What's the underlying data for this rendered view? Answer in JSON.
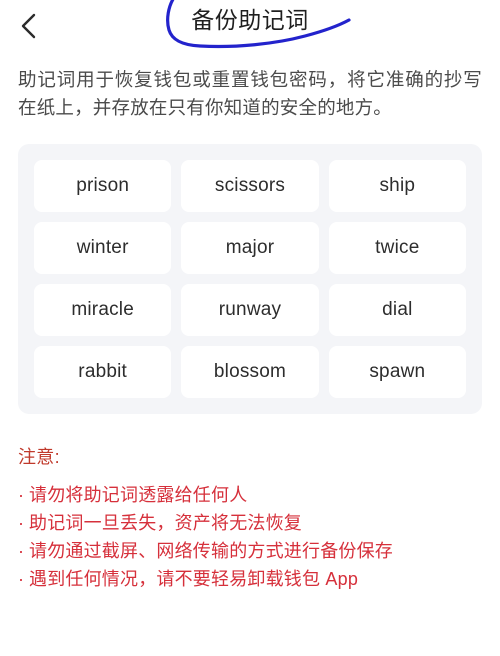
{
  "header": {
    "back_icon": "chevron-left-icon",
    "title": "备份助记词",
    "annotation_color": "#2323cc"
  },
  "description": "助记词用于恢复钱包或重置钱包密码，将它准确的抄写在纸上，并存放在只有你知道的安全的地方。",
  "mnemonic": {
    "words": [
      "prison",
      "scissors",
      "ship",
      "winter",
      "major",
      "twice",
      "miracle",
      "runway",
      "dial",
      "rabbit",
      "blossom",
      "spawn"
    ],
    "panel_background": "#f4f5f8",
    "card_background": "#ffffff"
  },
  "warning": {
    "title": "注意:",
    "bullet": "·",
    "color": "#d6303b",
    "items": [
      "请勿将助记词透露给任何人",
      "助记词一旦丢失，资产将无法恢复",
      "请勿通过截屏、网络传输的方式进行备份保存",
      "遇到任何情况，请不要轻易卸载钱包 App"
    ]
  }
}
